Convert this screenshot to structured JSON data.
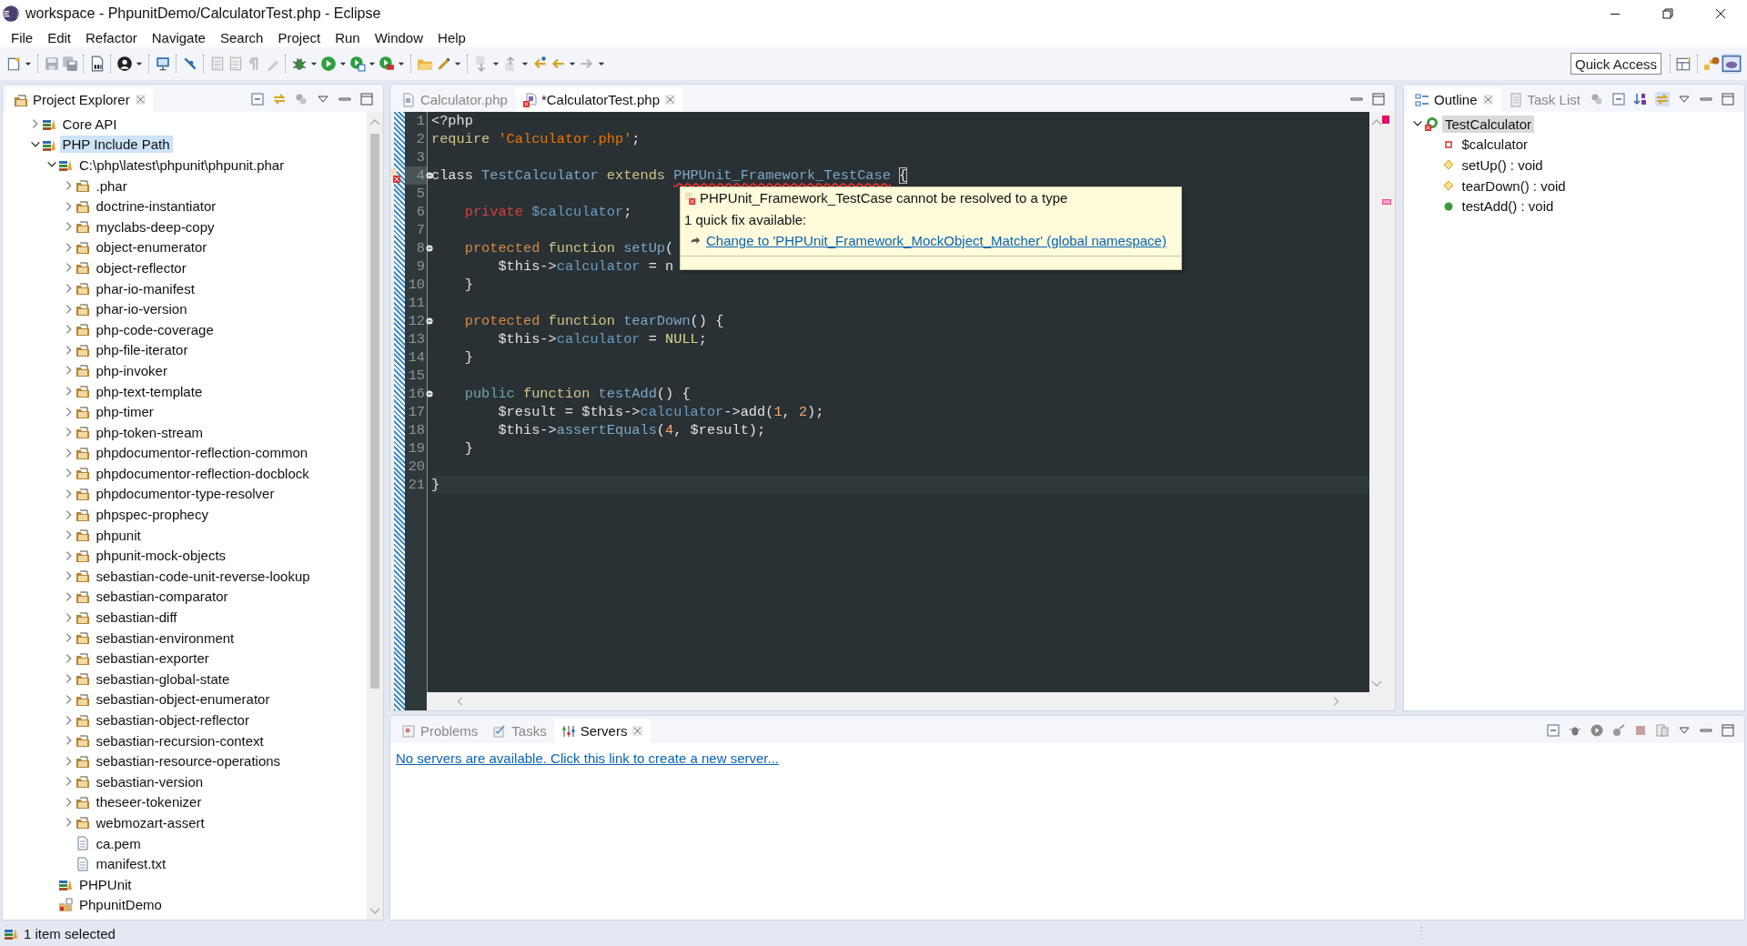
{
  "window": {
    "title": "workspace - PhpunitDemo/CalculatorTest.php - Eclipse"
  },
  "menu": [
    "File",
    "Edit",
    "Refactor",
    "Navigate",
    "Search",
    "Project",
    "Run",
    "Window",
    "Help"
  ],
  "quick_access": {
    "placeholder": "Quick Access"
  },
  "project_explorer": {
    "tab": {
      "label": "Project Explorer",
      "selected": true
    },
    "items": [
      {
        "label": "Core API",
        "kind": "library",
        "expanded": false,
        "selected": false
      },
      {
        "label": "PHP Include Path",
        "kind": "library",
        "expanded": true,
        "selected": true,
        "children": [
          {
            "label": "C:\\php\\latest\\phpunit\\phpunit.phar",
            "kind": "archive",
            "expanded": true,
            "selected": false,
            "children": [
              {
                "label": ".phar",
                "kind": "package",
                "expanded": false,
                "selected": false
              },
              {
                "label": "doctrine-instantiator",
                "kind": "package",
                "expanded": false,
                "selected": false
              },
              {
                "label": "myclabs-deep-copy",
                "kind": "package",
                "expanded": false,
                "selected": false
              },
              {
                "label": "object-enumerator",
                "kind": "package",
                "expanded": false,
                "selected": false
              },
              {
                "label": "object-reflector",
                "kind": "package",
                "expanded": false,
                "selected": false
              },
              {
                "label": "phar-io-manifest",
                "kind": "package",
                "expanded": false,
                "selected": false
              },
              {
                "label": "phar-io-version",
                "kind": "package",
                "expanded": false,
                "selected": false
              },
              {
                "label": "php-code-coverage",
                "kind": "package",
                "expanded": false,
                "selected": false
              },
              {
                "label": "php-file-iterator",
                "kind": "package",
                "expanded": false,
                "selected": false
              },
              {
                "label": "php-invoker",
                "kind": "package",
                "expanded": false,
                "selected": false
              },
              {
                "label": "php-text-template",
                "kind": "package",
                "expanded": false,
                "selected": false
              },
              {
                "label": "php-timer",
                "kind": "package",
                "expanded": false,
                "selected": false
              },
              {
                "label": "php-token-stream",
                "kind": "package",
                "expanded": false,
                "selected": false
              },
              {
                "label": "phpdocumentor-reflection-common",
                "kind": "package",
                "expanded": false,
                "selected": false
              },
              {
                "label": "phpdocumentor-reflection-docblock",
                "kind": "package",
                "expanded": false,
                "selected": false
              },
              {
                "label": "phpdocumentor-type-resolver",
                "kind": "package",
                "expanded": false,
                "selected": false
              },
              {
                "label": "phpspec-prophecy",
                "kind": "package",
                "expanded": false,
                "selected": false
              },
              {
                "label": "phpunit",
                "kind": "package",
                "expanded": false,
                "selected": false
              },
              {
                "label": "phpunit-mock-objects",
                "kind": "package",
                "expanded": false,
                "selected": false
              },
              {
                "label": "sebastian-code-unit-reverse-lookup",
                "kind": "package",
                "expanded": false,
                "selected": false
              },
              {
                "label": "sebastian-comparator",
                "kind": "package",
                "expanded": false,
                "selected": false
              },
              {
                "label": "sebastian-diff",
                "kind": "package",
                "expanded": false,
                "selected": false
              },
              {
                "label": "sebastian-environment",
                "kind": "package",
                "expanded": false,
                "selected": false
              },
              {
                "label": "sebastian-exporter",
                "kind": "package",
                "expanded": false,
                "selected": false
              },
              {
                "label": "sebastian-global-state",
                "kind": "package",
                "expanded": false,
                "selected": false
              },
              {
                "label": "sebastian-object-enumerator",
                "kind": "package",
                "expanded": false,
                "selected": false
              },
              {
                "label": "sebastian-object-reflector",
                "kind": "package",
                "expanded": false,
                "selected": false
              },
              {
                "label": "sebastian-recursion-context",
                "kind": "package",
                "expanded": false,
                "selected": false
              },
              {
                "label": "sebastian-resource-operations",
                "kind": "package",
                "expanded": false,
                "selected": false
              },
              {
                "label": "sebastian-version",
                "kind": "package",
                "expanded": false,
                "selected": false
              },
              {
                "label": "theseer-tokenizer",
                "kind": "package",
                "expanded": false,
                "selected": false
              },
              {
                "label": "webmozart-assert",
                "kind": "package",
                "expanded": false,
                "selected": false
              },
              {
                "label": "ca.pem",
                "kind": "file",
                "selected": false
              },
              {
                "label": "manifest.txt",
                "kind": "file",
                "selected": false
              }
            ]
          },
          {
            "label": "PHPUnit",
            "kind": "library",
            "selected": false
          },
          {
            "label": "PhpunitDemo",
            "kind": "project",
            "selected": false
          }
        ]
      }
    ]
  },
  "editor": {
    "tabs": [
      {
        "label": "Calculator.php",
        "selected": false,
        "error": false
      },
      {
        "label": "*CalculatorTest.php",
        "selected": true,
        "error": true
      }
    ],
    "lines": [
      {
        "number": "1",
        "tokens": [
          {
            "kind": "plain",
            "text": "<?php"
          }
        ]
      },
      {
        "number": "2",
        "tokens": [
          {
            "kind": "keyword",
            "text": "require"
          },
          {
            "kind": "string",
            "text": " 'Calculator.php'"
          },
          {
            "kind": "plain",
            "text": ";"
          }
        ]
      },
      {
        "number": "3"
      },
      {
        "number": "4",
        "error": true,
        "fold": true,
        "tokens": [
          {
            "kind": "plain",
            "text": "class"
          },
          {
            "kind": "type",
            "text": " TestCalculator"
          },
          {
            "kind": "keyword",
            "text": " extends "
          },
          {
            "kind": "type",
            "text": "PHPUnit_Framework_TestCase",
            "error": true
          },
          {
            "kind": "bracket",
            "text": " {"
          }
        ]
      },
      {
        "number": "5"
      },
      {
        "number": "6",
        "tokens": [
          {
            "kind": "private",
            "text": "    private"
          },
          {
            "kind": "field",
            "text": " $calculator"
          },
          {
            "kind": "plain",
            "text": ";"
          }
        ]
      },
      {
        "number": "7"
      },
      {
        "number": "8",
        "fold": true,
        "tokens": [
          {
            "kind": "protected",
            "text": "    protected"
          },
          {
            "kind": "keyword",
            "text": " function"
          },
          {
            "kind": "method",
            "text": " setUp"
          },
          {
            "kind": "plain",
            "text": "("
          }
        ]
      },
      {
        "number": "9",
        "tokens": [
          {
            "kind": "plain",
            "text": "        $this->"
          },
          {
            "kind": "field",
            "text": "calculator"
          },
          {
            "kind": "plain",
            "text": " = n"
          }
        ]
      },
      {
        "number": "10",
        "tokens": [
          {
            "kind": "plain",
            "text": "    }"
          }
        ]
      },
      {
        "number": "11"
      },
      {
        "number": "12",
        "fold": true,
        "tokens": [
          {
            "kind": "protected",
            "text": "    protected"
          },
          {
            "kind": "keyword",
            "text": " function"
          },
          {
            "kind": "method",
            "text": " tearDown"
          },
          {
            "kind": "plain",
            "text": "() {"
          }
        ]
      },
      {
        "number": "13",
        "tokens": [
          {
            "kind": "plain",
            "text": "        $this->"
          },
          {
            "kind": "field",
            "text": "calculator"
          },
          {
            "kind": "plain",
            "text": " = "
          },
          {
            "kind": "constant",
            "text": "NULL"
          },
          {
            "kind": "plain",
            "text": ";"
          }
        ]
      },
      {
        "number": "14",
        "tokens": [
          {
            "kind": "plain",
            "text": "    }"
          }
        ]
      },
      {
        "number": "15"
      },
      {
        "number": "16",
        "fold": true,
        "tokens": [
          {
            "kind": "public",
            "text": "    public"
          },
          {
            "kind": "keyword",
            "text": " function"
          },
          {
            "kind": "method",
            "text": " testAdd"
          },
          {
            "kind": "plain",
            "text": "() {"
          }
        ]
      },
      {
        "number": "17",
        "tokens": [
          {
            "kind": "plain",
            "text": "        $result = $this->"
          },
          {
            "kind": "field",
            "text": "calculator"
          },
          {
            "kind": "plain",
            "text": "->add("
          },
          {
            "kind": "number",
            "text": "1"
          },
          {
            "kind": "plain",
            "text": ", "
          },
          {
            "kind": "number",
            "text": "2"
          },
          {
            "kind": "plain",
            "text": ");"
          }
        ]
      },
      {
        "number": "18",
        "tokens": [
          {
            "kind": "plain",
            "text": "        $this->"
          },
          {
            "kind": "method",
            "text": "assertEquals"
          },
          {
            "kind": "plain",
            "text": "("
          },
          {
            "kind": "number",
            "text": "4"
          },
          {
            "kind": "plain",
            "text": ", $result);"
          }
        ]
      },
      {
        "number": "19",
        "tokens": [
          {
            "kind": "plain",
            "text": "    }"
          }
        ]
      },
      {
        "number": "20"
      },
      {
        "number": "21",
        "current": true,
        "tokens": [
          {
            "kind": "plain",
            "text": "}"
          }
        ]
      }
    ],
    "hover": {
      "problem": "PHPUnit_Framework_TestCase cannot be resolved to a type",
      "summary": "1 quick fix available:",
      "fix": "Change to 'PHPUnit_Framework_MockObject_Matcher' (global namespace)"
    }
  },
  "outline": {
    "tabs": [
      {
        "label": "Outline",
        "selected": true
      },
      {
        "label": "Task List",
        "selected": false
      }
    ],
    "items": [
      {
        "label": "TestCalculator",
        "kind": "class",
        "expanded": true,
        "selected": true,
        "children": [
          {
            "label": "$calculator",
            "kind": "private-field",
            "selected": false
          },
          {
            "label": "setUp() : void",
            "kind": "protected-method",
            "selected": false
          },
          {
            "label": "tearDown() : void",
            "kind": "protected-method",
            "selected": false
          },
          {
            "label": "testAdd() : void",
            "kind": "public-method",
            "selected": false
          }
        ]
      }
    ]
  },
  "bottom_panel": {
    "tabs": [
      {
        "label": "Problems",
        "selected": false
      },
      {
        "label": "Tasks",
        "selected": false
      },
      {
        "label": "Servers",
        "selected": true
      }
    ],
    "link": "No servers are available. Click this link to create a new server..."
  },
  "status_bar": {
    "text": "1 item selected"
  }
}
